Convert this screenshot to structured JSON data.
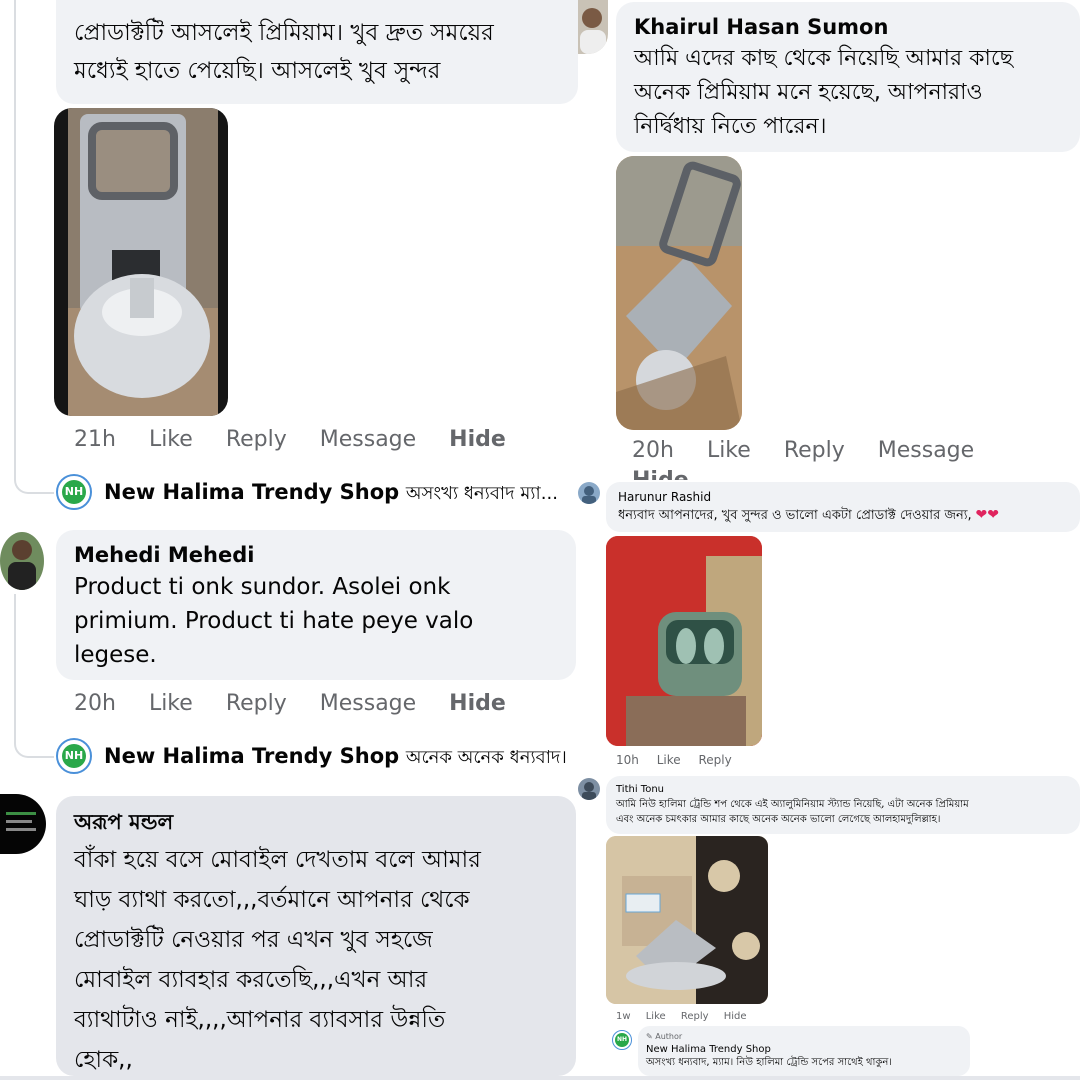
{
  "colors": {
    "bubble": "#f0f2f5",
    "bubble_dark": "#e4e6eb",
    "meta": "#65676b",
    "heart": "#e0245e",
    "shop_green": "#2aa84a"
  },
  "top_left": {
    "text_line1": "প্রোডাক্টটি আসলেই প্রিমিয়াম। খুব দ্রুত সময়ের",
    "text_line2": "মধ্যেই হাতে পেয়েছি। আসলেই খুব সুন্দর",
    "actions": {
      "time": "21h",
      "like": "Like",
      "reply": "Reply",
      "message": "Message",
      "hide": "Hide"
    },
    "shop_reply": {
      "name": "New Halima Trendy Shop",
      "text": "অসংখ্য ধন্যবাদ ম্যা..."
    }
  },
  "top_right": {
    "name": "Khairul Hasan Sumon",
    "text_line1": "আমি এদের কাছ থেকে নিয়েছি আমার কাছে",
    "text_line2": "অনেক প্রিমিয়াম মনে হয়েছে, আপনারাও",
    "text_line3": "নির্দ্বিধায় নিতে পারেন।",
    "actions": {
      "time": "20h",
      "like": "Like",
      "reply": "Reply",
      "message": "Message",
      "hide": "Hide"
    }
  },
  "mid_left": {
    "name": "Mehedi Mehedi",
    "text_line1": "Product ti onk sundor. Asolei onk",
    "text_line2": "primium.  Product ti hate peye valo",
    "text_line3": "legese.",
    "actions": {
      "time": "20h",
      "like": "Like",
      "reply": "Reply",
      "message": "Message",
      "hide": "Hide"
    },
    "shop_reply": {
      "name": "New Halima Trendy Shop",
      "text": "অনেক অনেক ধন্যবাদ।"
    }
  },
  "mid_right": {
    "name": "Harunur Rashid",
    "text": "ধন্যবাদ আপনাদের, খুব সুন্দর ও ভালো একটা প্রোডাক্ট দেওয়ার জন্য,",
    "hearts": "❤❤",
    "actions": {
      "time": "10h",
      "like": "Like",
      "reply": "Reply"
    }
  },
  "bottom_left": {
    "name": "অরূপ মন্ডল",
    "lines": [
      "বাঁকা হয়ে বসে মোবাইল দেখতাম বলে আমার",
      "ঘাড় ব্যাথা করতো,,,বর্তমানে আপনার থেকে",
      "প্রোডাক্টটি নেওয়ার পর এখন খুব সহজে",
      "মোবাইল ব্যাবহার করতেছি,,,এখন আর",
      "ব্যাথাটাও নাই,,,,আপনার ব্যাবসার উন্নতি",
      "হোক,,"
    ]
  },
  "bottom_right": {
    "name": "Tithi Tonu",
    "text_line1": "আমি নিউ হালিমা ট্রেন্ডি শপ থেকে এই অ্যালুমিনিয়াম স্ট্যান্ড নিয়েছি, এটা অনেক প্রিমিয়াম",
    "text_line2": "এবং অনেক চমৎকার আমার কাছে অনেক অনেক ভালো লেগেছে আলহামদুলিল্লাহ।",
    "actions": {
      "time": "1w",
      "like": "Like",
      "reply": "Reply",
      "hide": "Hide"
    },
    "author_badge": "Author",
    "shop_name": "New Halima Trendy Shop",
    "shop_text": "অসংখ্য ধন্যবাদ, ম্যাম। নিউ হালিমা ট্রেন্ডি সপের সাথেই থাকুন।"
  }
}
